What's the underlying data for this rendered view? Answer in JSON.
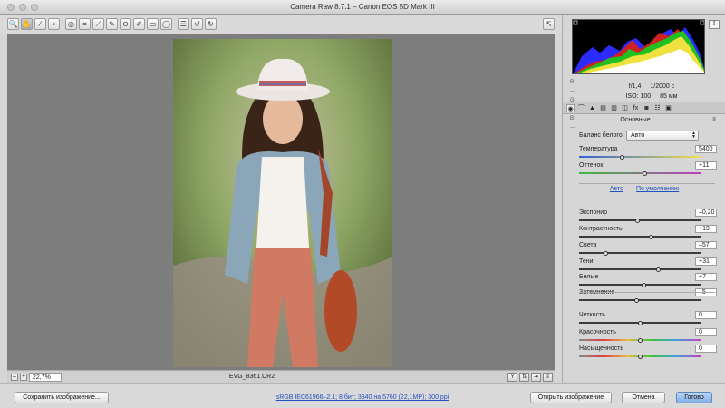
{
  "window": {
    "title": "Camera Raw 8.7.1  –  Canon EOS 5D Mark III"
  },
  "toolbar": {
    "tools": [
      {
        "name": "zoom-tool",
        "glyph": "🔍"
      },
      {
        "name": "hand-tool",
        "glyph": "✋"
      },
      {
        "name": "white-balance-tool",
        "glyph": "⁄"
      },
      {
        "name": "color-sampler-tool",
        "glyph": "⌖"
      },
      {
        "name": "targeted-adjustment-tool",
        "glyph": "◎"
      },
      {
        "name": "crop-tool",
        "glyph": "⌗"
      },
      {
        "name": "straighten-tool",
        "glyph": "⟋"
      },
      {
        "name": "spot-removal-tool",
        "glyph": "✎"
      },
      {
        "name": "red-eye-tool",
        "glyph": "⊙"
      },
      {
        "name": "adjustment-brush-tool",
        "glyph": "✐"
      },
      {
        "name": "graduated-filter-tool",
        "glyph": "▭"
      },
      {
        "name": "radial-filter-tool",
        "glyph": "◯"
      },
      {
        "name": "preferences-tool",
        "glyph": "☰"
      },
      {
        "name": "rotate-left-tool",
        "glyph": "↺"
      },
      {
        "name": "rotate-right-tool",
        "glyph": "↻"
      }
    ],
    "fullscreen_glyph": "⇱"
  },
  "status": {
    "zoom": "22,7%",
    "filename": "EVG_8361.CR2",
    "zoom_out": "–",
    "zoom_in": "+"
  },
  "footer": {
    "save_label": "Сохранить изображение...",
    "workflow_link": "sRGB IEC61966–2.1; 8 бит; 3840 на 5760 (22,1MP); 300 ppi",
    "open_label": "Открыть изображение",
    "cancel_label": "Отмена",
    "done_label": "Готово"
  },
  "info": {
    "r_label": "R:",
    "g_label": "G:",
    "b_label": "B:",
    "r_value": "---",
    "g_value": "---",
    "b_value": "---",
    "aperture": "f/1,4",
    "shutter": "1/2000 с",
    "iso": "ISO: 100",
    "focal": "85 мм"
  },
  "panel": {
    "section_title": "Основные",
    "section_menu_glyph": "≡",
    "white_balance_label": "Баланс белого:",
    "white_balance_value": "Авто",
    "auto_link": "Авто",
    "default_link": "По умолчанию",
    "tabs": [
      {
        "name": "tab-basic",
        "glyph": "◉"
      },
      {
        "name": "tab-tone-curve",
        "glyph": "⌒"
      },
      {
        "name": "tab-detail",
        "glyph": "▲"
      },
      {
        "name": "tab-hsl",
        "glyph": "▤"
      },
      {
        "name": "tab-split-toning",
        "glyph": "▥"
      },
      {
        "name": "tab-lens-corrections",
        "glyph": "◫"
      },
      {
        "name": "tab-effects",
        "glyph": "fx"
      },
      {
        "name": "tab-camera-calibration",
        "glyph": "◙"
      },
      {
        "name": "tab-presets",
        "glyph": "☷"
      },
      {
        "name": "tab-snapshots",
        "glyph": "▣"
      }
    ]
  },
  "sliders": [
    {
      "label": "Температура",
      "value": "5400",
      "level": 0.35,
      "track": "linear-gradient(90deg,#2c5fd6,#f0e04a)"
    },
    {
      "label": "Оттенок",
      "value": "+11",
      "level": 0.54,
      "track": "linear-gradient(90deg,#3bbd3b,#c23bc2)"
    },
    {
      "label": "Экспонир",
      "value": "–0,20",
      "level": 0.48
    },
    {
      "label": "Контрастность",
      "value": "+19",
      "level": 0.59
    },
    {
      "label": "Света",
      "value": "–57",
      "level": 0.22
    },
    {
      "label": "Тени",
      "value": "+31",
      "level": 0.65
    },
    {
      "label": "Белые",
      "value": "+7",
      "level": 0.53
    },
    {
      "label": "Затемнение",
      "value": "–5",
      "level": 0.47
    },
    {
      "label": "Четкость",
      "value": "0",
      "level": 0.5
    },
    {
      "label": "Красочность",
      "value": "0",
      "level": 0.5,
      "track": "linear-gradient(90deg,#8a8a8a,#e04040,#e0c040,#40c040,#40a0e0,#c040c0)"
    },
    {
      "label": "Насыщенность",
      "value": "0",
      "level": 0.5,
      "track": "linear-gradient(90deg,#8a8a8a,#e04040,#e0c040,#40c040,#40a0e0,#c040c0)"
    }
  ]
}
